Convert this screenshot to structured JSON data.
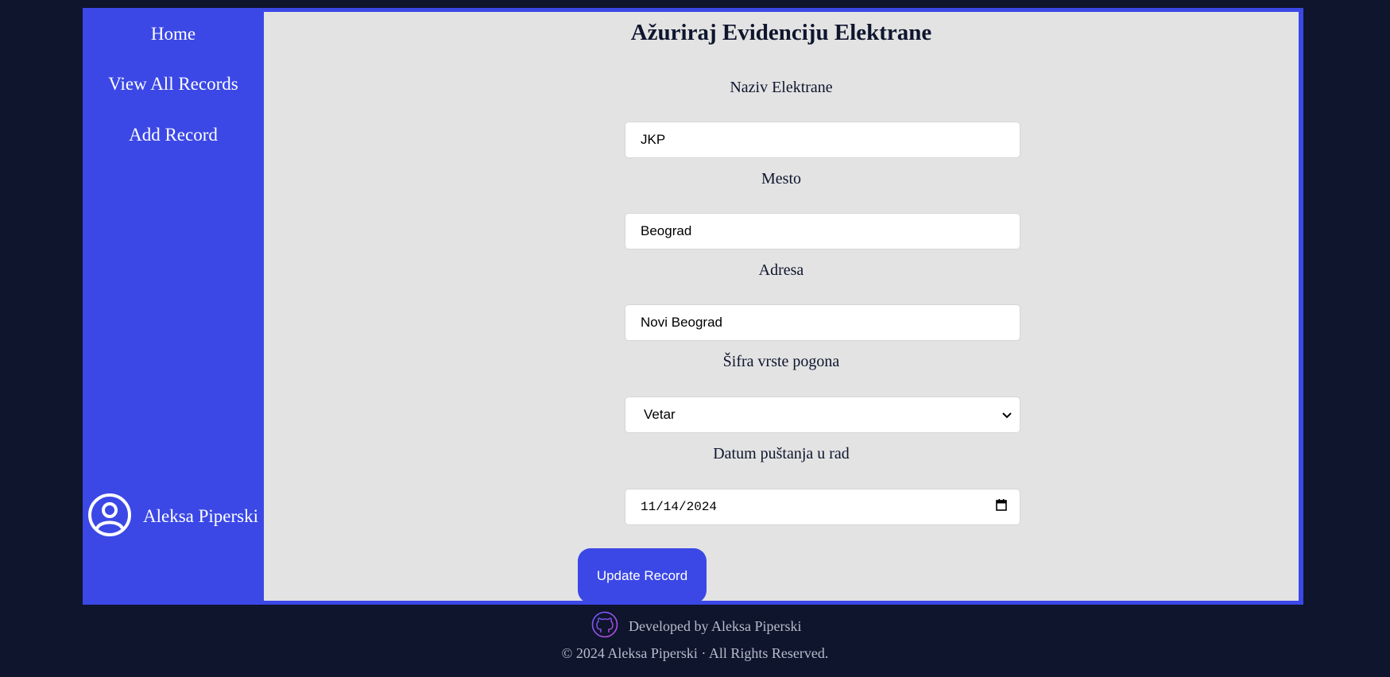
{
  "sidebar": {
    "nav": [
      "Home",
      "View All Records",
      "Add Record"
    ],
    "user_name": "Aleksa Piperski",
    "user_icon": "user-circle-icon"
  },
  "form": {
    "title": "Ažuriraj Evidenciju Elektrane",
    "fields": [
      {
        "label": "Naziv Elektrane",
        "value": "JKP"
      },
      {
        "label": "Mesto",
        "value": "Beograd"
      },
      {
        "label": "Adresa",
        "value": "Novi Beograd"
      },
      {
        "label": "Šifra vrste pogona",
        "value": "Vetar"
      },
      {
        "label": "Datum puštanja u rad",
        "value": "11/14/2024"
      }
    ],
    "submit_label": "Update Record"
  },
  "footer": {
    "developed_by": "Developed by Aleksa Piperski",
    "copyright": "© 2024 Aleksa Piperski · All Rights Reserved.",
    "github_icon": "github-icon"
  },
  "colors": {
    "accent": "#3b48e6",
    "background": "#0e152d",
    "panel": "#e3e3e3"
  }
}
